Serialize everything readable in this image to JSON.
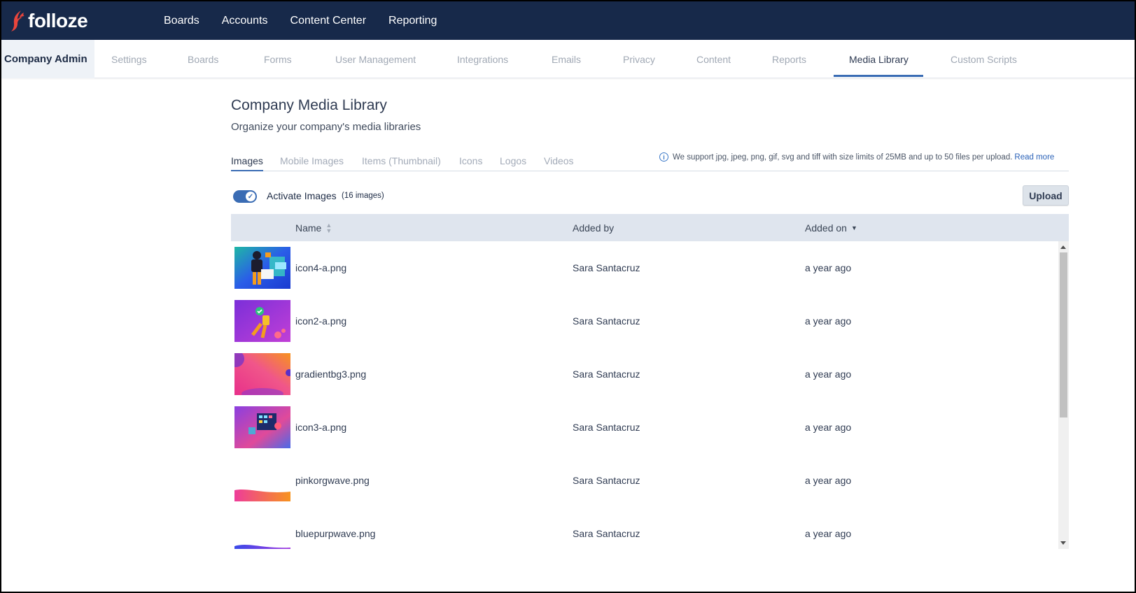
{
  "brand": {
    "name": "folloze",
    "logo_icon": "folloze-flame-logo",
    "nav_bg": "#17294a",
    "accent": "#3a6cb4"
  },
  "top_nav": [
    "Boards",
    "Accounts",
    "Content Center",
    "Reporting"
  ],
  "admin": {
    "title": "Company Admin",
    "tabs": [
      "Settings",
      "Boards",
      "Forms",
      "User Management",
      "Integrations",
      "Emails",
      "Privacy",
      "Content",
      "Reports",
      "Media Library",
      "Custom Scripts"
    ],
    "active_tab": "Media Library"
  },
  "page": {
    "title": "Company Media Library",
    "subtitle": "Organize your company's media libraries"
  },
  "media_tabs": {
    "items": [
      "Images",
      "Mobile Images",
      "Items (Thumbnail)",
      "Icons",
      "Logos",
      "Videos"
    ],
    "active": "Images"
  },
  "info": {
    "icon": "info-icon",
    "text": "We support jpg, jpeg, png, gif, svg and tiff with size limits of 25MB and up to 50 files per upload.",
    "link": "Read more"
  },
  "toggle": {
    "label": "Activate Images",
    "count": "(16 images)",
    "on": true
  },
  "upload_label": "Upload",
  "table": {
    "columns": {
      "name": "Name",
      "added_by": "Added by",
      "added_on": "Added on"
    },
    "sort": {
      "column": "Added on",
      "direction": "descending"
    },
    "rows": [
      {
        "name": "icon4-a.png",
        "added_by": "Sara Santacruz",
        "added_on": "a year ago"
      },
      {
        "name": "icon2-a.png",
        "added_by": "Sara Santacruz",
        "added_on": "a year ago"
      },
      {
        "name": "gradientbg3.png",
        "added_by": "Sara Santacruz",
        "added_on": "a year ago"
      },
      {
        "name": "icon3-a.png",
        "added_by": "Sara Santacruz",
        "added_on": "a year ago"
      },
      {
        "name": "pinkorgwave.png",
        "added_by": "Sara Santacruz",
        "added_on": "a year ago"
      },
      {
        "name": "bluepurpwave.png",
        "added_by": "Sara Santacruz",
        "added_on": "a year ago"
      }
    ]
  }
}
